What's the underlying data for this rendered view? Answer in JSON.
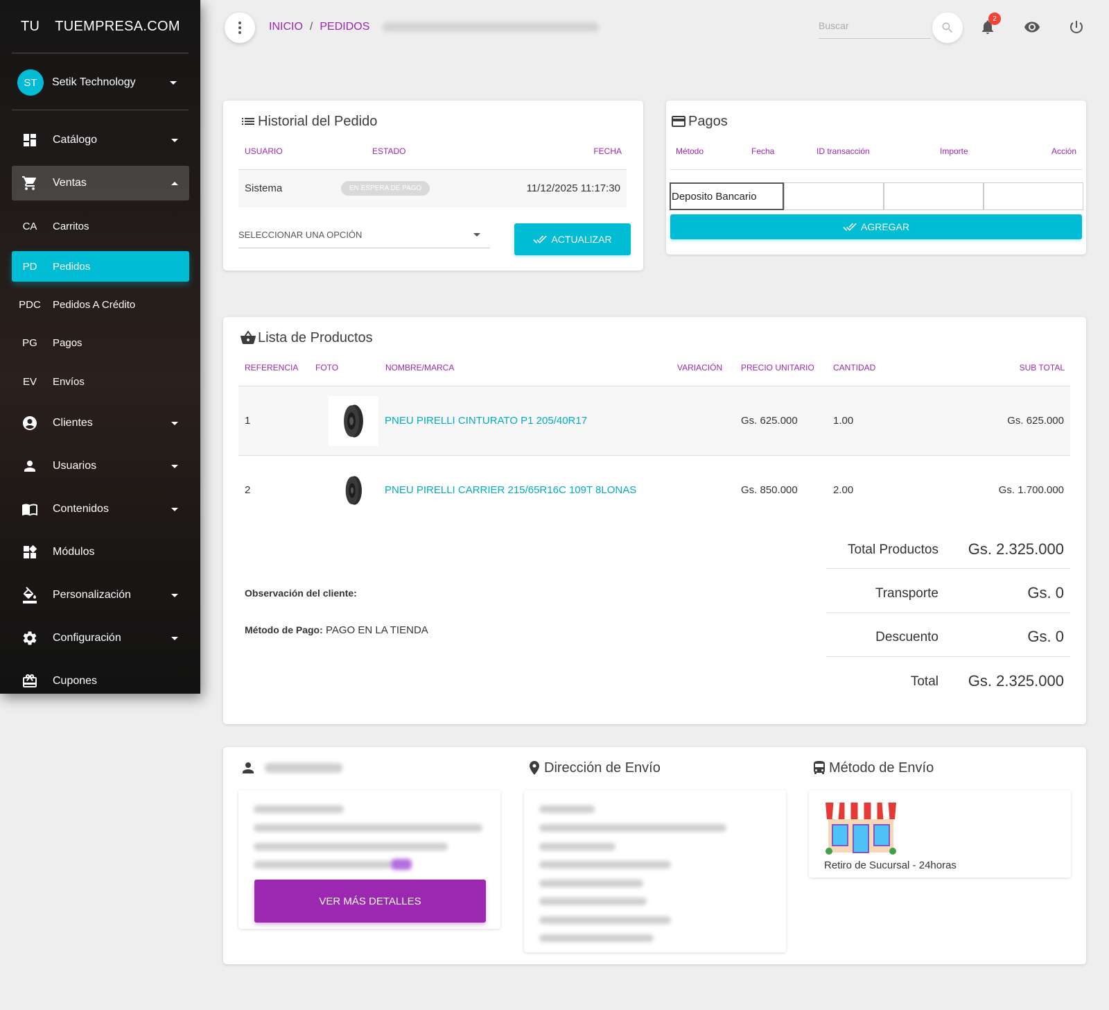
{
  "sidebar": {
    "logo_short": "TU",
    "logo_full": "TUEMPRESA.COM",
    "user": {
      "initials": "ST",
      "name": "Setik Technology"
    },
    "items": [
      {
        "label": "Catálogo"
      },
      {
        "label": "Ventas"
      },
      {
        "abbr": "CA",
        "label": "Carritos"
      },
      {
        "abbr": "PD",
        "label": "Pedidos"
      },
      {
        "abbr": "PDC",
        "label": "Pedidos A Crédito"
      },
      {
        "abbr": "PG",
        "label": "Pagos"
      },
      {
        "abbr": "EV",
        "label": "Envíos"
      },
      {
        "label": "Clientes"
      },
      {
        "label": "Usuarios"
      },
      {
        "label": "Contenidos"
      },
      {
        "label": "Módulos"
      },
      {
        "label": "Personalización"
      },
      {
        "label": "Configuración"
      },
      {
        "label": "Cupones"
      }
    ]
  },
  "header": {
    "breadcrumb": [
      "INICIO",
      "PEDIDOS"
    ],
    "search_placeholder": "Buscar",
    "notification_count": "2"
  },
  "history": {
    "title": "Historial del Pedido",
    "columns": [
      "USUARIO",
      "ESTADO",
      "FECHA"
    ],
    "row": {
      "user": "Sistema",
      "status": "EN ESPERA DE PAGO",
      "date": "11/12/2025 11:17:30"
    },
    "select_placeholder": "SELECCIONAR UNA OPCIÓN",
    "update_button": "ACTUALIZAR"
  },
  "payments": {
    "title": "Pagos",
    "columns": [
      "Método",
      "Fecha",
      "ID transacción",
      "Importe",
      "Acción"
    ],
    "method_value": "Deposito Bancario",
    "add_button": "AGREGAR"
  },
  "products": {
    "title": "Lista de Productos",
    "columns": [
      "REFERENCIA",
      "FOTO",
      "NOMBRE/MARCA",
      "VARIACIÓN",
      "PRECIO UNITARIO",
      "CANTIDAD",
      "SUB TOTAL"
    ],
    "rows": [
      {
        "ref": "1",
        "name": "PNEU PIRELLI CINTURATO P1 205/40R17",
        "variation": "",
        "price": "Gs. 625.000",
        "qty": "1.00",
        "subtotal": "Gs. 625.000"
      },
      {
        "ref": "2",
        "name": "PNEU PIRELLI CARRIER 215/65R16C 109T 8LONAS",
        "variation": "",
        "price": "Gs. 850.000",
        "qty": "2.00",
        "subtotal": "Gs. 1.700.000"
      }
    ],
    "observation_label": "Observación del cliente:",
    "payment_method_label": "Método de Pago:",
    "payment_method_value": "PAGO EN LA TIENDA",
    "totals": [
      {
        "label": "Total Productos",
        "value": "Gs. 2.325.000"
      },
      {
        "label": "Transporte",
        "value": "Gs. 0"
      },
      {
        "label": "Descuento",
        "value": "Gs. 0"
      },
      {
        "label": "Total",
        "value": "Gs. 2.325.000"
      }
    ]
  },
  "customer": {
    "details_button": "VER MÁS DETALLES"
  },
  "shipping_address": {
    "title": "Dirección de Envío"
  },
  "shipping_method": {
    "title": "Método de Envío",
    "option": "Retiro de Sucursal - 24horas"
  },
  "colors": {
    "accent_cyan": "#00bcd4",
    "accent_purple": "#9c27b0",
    "badge_red": "#f44336"
  }
}
